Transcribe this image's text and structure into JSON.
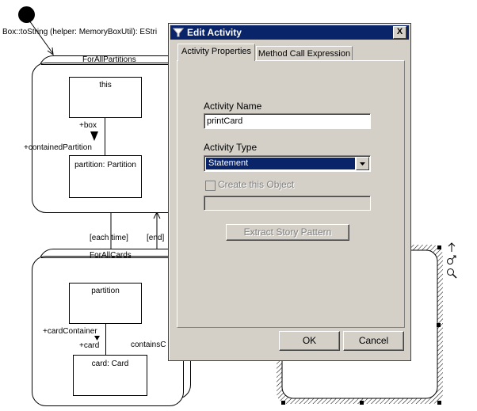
{
  "diagram": {
    "start_label": "Box::toString (helper: MemoryBoxUtil): EStri",
    "partitions_state": {
      "title": "ForAllPartitions",
      "this_object": "this",
      "link_box": "+box",
      "link_contained": "+containedPartition",
      "partition_object": "partition: Partition"
    },
    "transition_each": "[each time]",
    "transition_end": "[end]",
    "cards_state": {
      "title": "ForAllCards",
      "partition_object": "partition",
      "link_card_container": "+cardContainer",
      "link_card": "+card",
      "link_contains": "containsC",
      "card_object": "card: Card"
    }
  },
  "dialog": {
    "title": "Edit Activity",
    "close_symbol": "X",
    "tabs": [
      {
        "label": "Activity Properties",
        "active": true
      },
      {
        "label": "Method Call Expression",
        "active": false
      }
    ],
    "activity_name_label": "Activity Name",
    "activity_name_value": "printCard",
    "activity_type_label": "Activity Type",
    "activity_type_value": "Statement",
    "create_object_label": "Create this Object",
    "extract_button": "Extract Story Pattern",
    "ok_button": "OK",
    "cancel_button": "Cancel"
  }
}
